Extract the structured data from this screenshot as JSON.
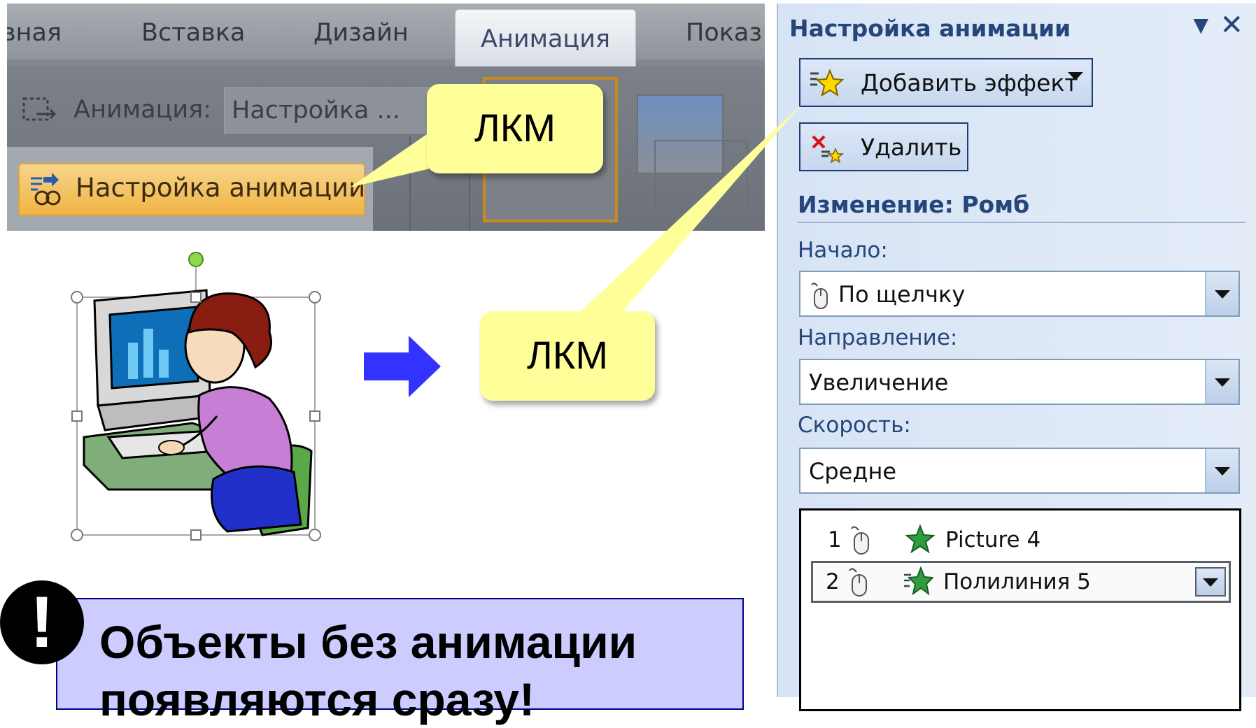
{
  "ribbon": {
    "tabs": [
      "вная",
      "Вставка",
      "Дизайн",
      "Анимация",
      "Показ"
    ],
    "active_tab": "Анимация",
    "animation_label": "Анимация:",
    "animation_value": "Настройка ...",
    "custom_animation_button": "Настройка анимации"
  },
  "callouts": {
    "ribbon_click": "ЛКМ",
    "add_effect_click": "ЛКМ"
  },
  "pane": {
    "title": "Настройка анимации",
    "add_effect": "Добавить эффект",
    "remove": "Удалить",
    "section": "Изменение: Ромб",
    "start_label": "Начало:",
    "start_value": "По щелчку",
    "direction_label": "Направление:",
    "direction_value": "Увеличение",
    "speed_label": "Скорость:",
    "speed_value": "Средне",
    "effects": [
      {
        "num": "1",
        "name": "Picture 4"
      },
      {
        "num": "2",
        "name": "Полилиния 5"
      }
    ]
  },
  "note": {
    "mark": "!",
    "line1": "Объекты без анимации",
    "line2": "появляются сразу!"
  },
  "colors": {
    "callout": "#ffff99",
    "note_bg": "#ccccff",
    "arrow": "#3333ff",
    "pane_bg": "#d7e4f5"
  }
}
